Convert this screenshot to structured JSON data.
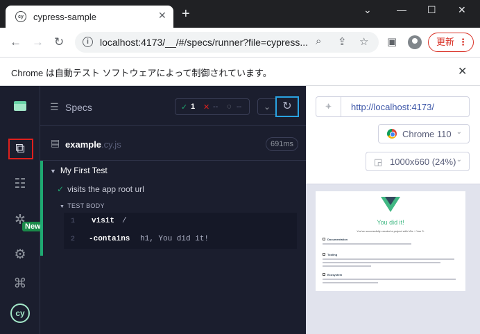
{
  "browser": {
    "tab_title": "cypress-sample",
    "tab_favicon_text": "cy",
    "url": "localhost:4173/__/#/specs/runner?file=cypress...",
    "update_label": "更新",
    "infobar_text": "Chrome は自動テスト ソフトウェアによって制御されています。"
  },
  "sidebar": {
    "new_badge": "New",
    "logo_text": "cy"
  },
  "reporter": {
    "specs_label": "Specs",
    "stats": {
      "passed": "1",
      "failed": "--",
      "pending": "--"
    },
    "file_name": "example",
    "file_ext": ".cy.js",
    "duration": "691ms",
    "suite_title": "My First Test",
    "test_title": "visits the app root url",
    "body_label": "TEST BODY",
    "commands": [
      {
        "num": "1",
        "name": "visit",
        "arg": "/"
      },
      {
        "num": "2",
        "name": "-contains",
        "arg": "h1, You did it!"
      }
    ]
  },
  "preview": {
    "url": "http://localhost:4173/",
    "browser": "Chrome 110",
    "viewport": "1000x660 (24%)",
    "app_title": "You did it!",
    "app_subtitle": "You've successfully created a project with Vite + Vue 3.",
    "sections": [
      "Documentation",
      "Tooling",
      "Ecosystem"
    ]
  },
  "colors": {
    "sidebar_bg": "#1b1e2e",
    "pass_green": "#1fa971",
    "rerun_highlight": "#29a3e2",
    "nav_highlight": "#e0201d",
    "vue_green": "#41b883"
  }
}
